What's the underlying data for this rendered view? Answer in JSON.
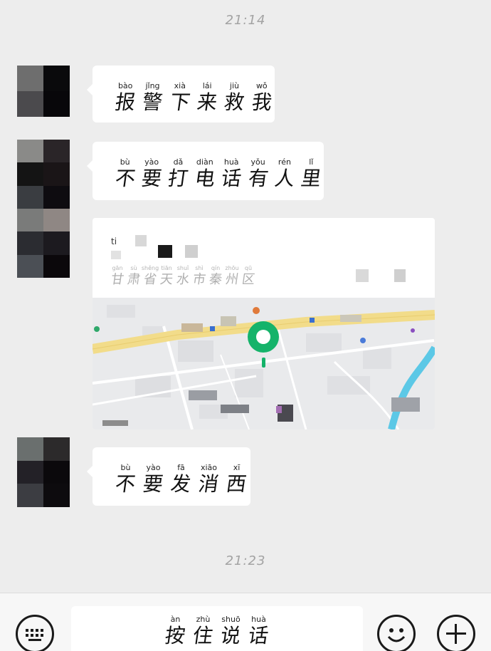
{
  "chat": {
    "timestamps": [
      "21:14",
      "21:23"
    ],
    "messages": [
      {
        "pinyin": [
          "bào",
          "jǐng",
          "xià",
          "lái",
          "jiù",
          "wǒ"
        ],
        "chars": [
          "报",
          "警",
          "下",
          "来",
          "救",
          "我"
        ]
      },
      {
        "pinyin": [
          "bù",
          "yào",
          "dǎ",
          "diàn",
          "huà",
          "yǒu",
          "rén",
          "lǐ"
        ],
        "chars": [
          "不",
          "要",
          "打",
          "电",
          "话",
          "有",
          "人",
          "里"
        ]
      },
      {
        "pinyin": [
          "bù",
          "yào",
          "fā",
          "xiāo",
          "xī"
        ],
        "chars": [
          "不",
          "要",
          "发",
          "消",
          "西"
        ]
      }
    ],
    "location": {
      "title_pinyin": [
        "ti"
      ],
      "address_pinyin": [
        "gān",
        "sù",
        "shěng",
        "tiān",
        "shuǐ",
        "shì",
        "qín",
        "zhōu",
        "qū"
      ],
      "address_chars": [
        "甘",
        "肃",
        "省",
        "天",
        "水",
        "市",
        "秦",
        "州",
        "区"
      ]
    }
  },
  "input_bar": {
    "hold_to_talk_pinyin": [
      "àn",
      "zhù",
      "shuō",
      "huà"
    ],
    "hold_to_talk_chars": [
      "按",
      "住",
      "说",
      "话"
    ],
    "keyboard_icon": "keyboard-icon",
    "emoji_icon": "emoji-icon",
    "plus_icon": "plus-icon"
  },
  "colors": {
    "background": "#ededed",
    "bubble": "#ffffff",
    "map_pin": "#15b36a",
    "map_road": "#f2dc8a",
    "river": "#5cc8e6"
  }
}
